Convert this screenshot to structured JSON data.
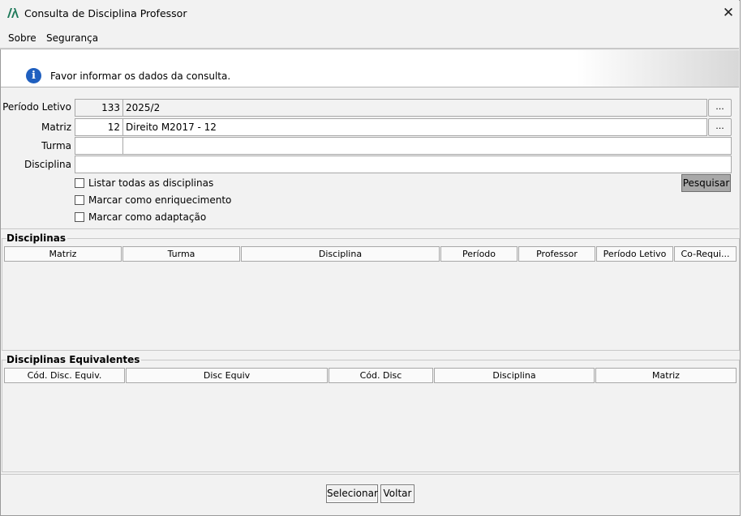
{
  "window": {
    "title": "Consulta de Disciplina Professor",
    "close_symbol": "✕"
  },
  "menu": {
    "items": [
      "Sobre",
      "Segurança"
    ]
  },
  "info": {
    "message": "Favor informar os dados da consulta.",
    "icon": "info-icon",
    "icon_glyph": "i"
  },
  "form": {
    "periodo_letivo": {
      "label": "Período Letivo",
      "code": "133",
      "value": "2025/2",
      "button": "..."
    },
    "matriz": {
      "label": "Matriz",
      "code": "12",
      "value": "Direito M2017 - 12",
      "button": "..."
    },
    "turma": {
      "label": "Turma",
      "code": "",
      "value": ""
    },
    "disciplina": {
      "label": "Disciplina",
      "value": ""
    },
    "checkboxes": [
      {
        "label": "Listar todas as disciplinas",
        "checked": false
      },
      {
        "label": "Marcar como enriquecimento",
        "checked": false
      },
      {
        "label": "Marcar como adaptação",
        "checked": false
      }
    ],
    "search_button": "Pesquisar"
  },
  "disciplinas": {
    "title": "Disciplinas",
    "columns": [
      "Matriz",
      "Turma",
      "Disciplina",
      "Período",
      "Professor",
      "Período Letivo",
      "Co-Requi..."
    ],
    "rows": []
  },
  "equivalentes": {
    "title": "Disciplinas Equivalentes",
    "columns": [
      "Cód. Disc. Equiv.",
      "Disc Equiv",
      "Cód. Disc",
      "Disciplina",
      "Matriz"
    ],
    "rows": []
  },
  "footer": {
    "select_button": "Selecionar",
    "back_button": "Voltar"
  }
}
